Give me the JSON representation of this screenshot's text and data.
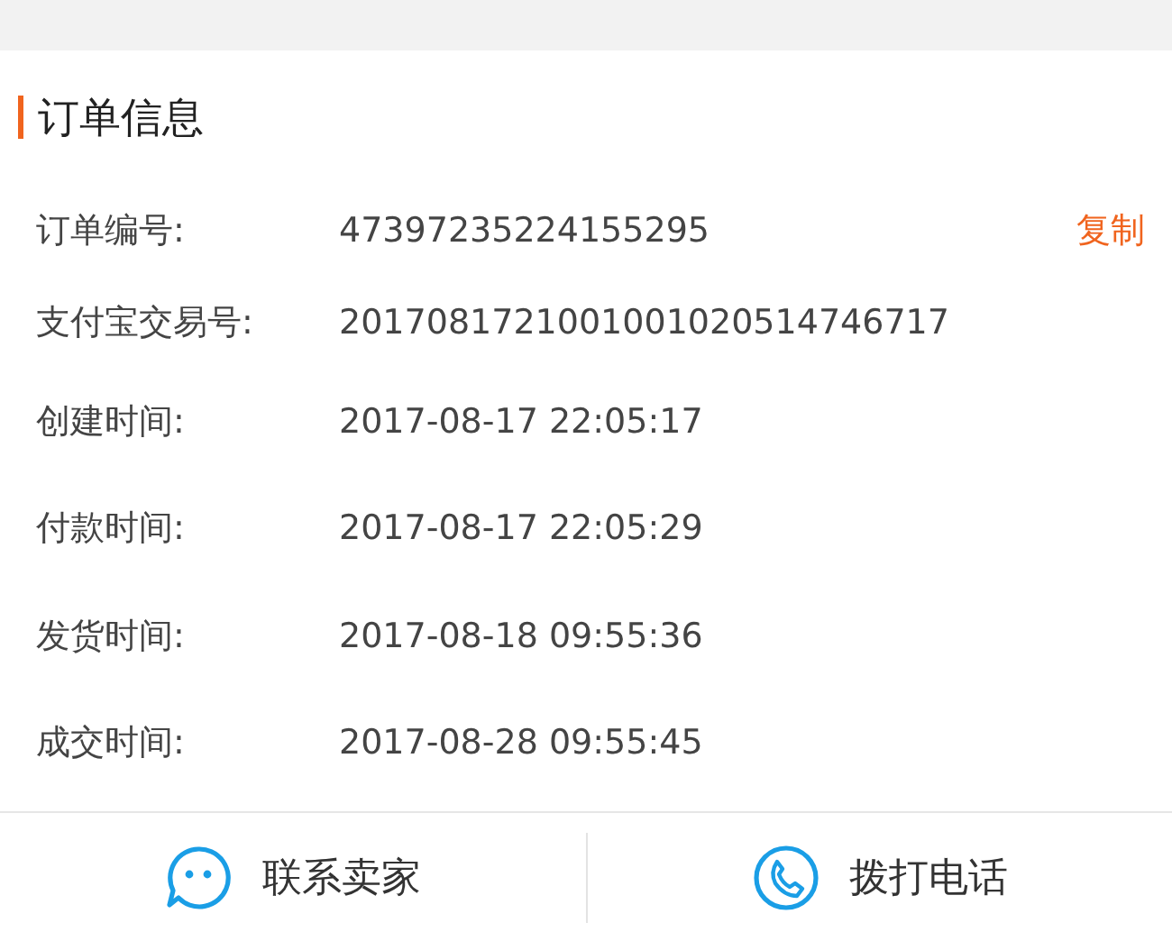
{
  "section": {
    "title": "订单信息"
  },
  "rows": [
    {
      "label": "订单编号:",
      "value": "47397235224155295",
      "action": "复制"
    },
    {
      "label": "支付宝交易号:",
      "value": "2017081721001001020514746717"
    },
    {
      "label": "创建时间:",
      "value": "2017-08-17 22:05:17"
    },
    {
      "label": "付款时间:",
      "value": "2017-08-17 22:05:29"
    },
    {
      "label": "发货时间:",
      "value": "2017-08-18 09:55:36"
    },
    {
      "label": "成交时间:",
      "value": "2017-08-28 09:55:45"
    }
  ],
  "actions": [
    {
      "kind": "chat",
      "label": "联系卖家"
    },
    {
      "kind": "phone",
      "label": "拨打电话"
    }
  ]
}
